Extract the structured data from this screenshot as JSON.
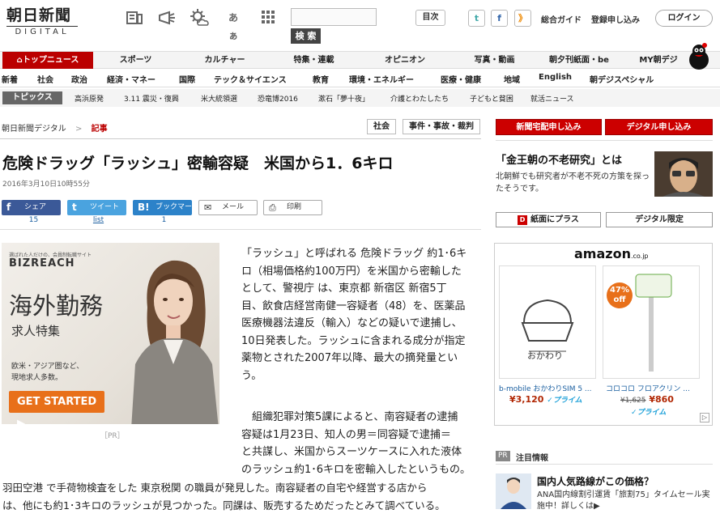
{
  "header": {
    "logo_top": "朝日新聞",
    "logo_bottom": "DIGITAL",
    "search_button": "検 索",
    "index_button": "目次",
    "twitter": "t",
    "facebook": "f",
    "rss": "》",
    "guide": "総合ガイド",
    "signup": "登録申し込み",
    "login": "ログイン",
    "lang_icon": "あぁ"
  },
  "nav_main": [
    "トップニュース",
    "スポーツ",
    "カルチャー",
    "特集・連載",
    "オピニオン",
    "写真・動画",
    "朝夕刊紙面・be",
    "MY朝デジ"
  ],
  "nav_sub": [
    "新着",
    "社会",
    "政治",
    "経済・マネー",
    "国際",
    "テック＆サイエンス",
    "教育",
    "環境・エネルギー",
    "医療・健康",
    "地域",
    "English",
    "朝デジスペシャル"
  ],
  "topics": {
    "label": "トピックス",
    "items": [
      "高浜原発",
      "3.11 震災・復興",
      "米大統領選",
      "恐竜博2016",
      "漱石「夢十夜」",
      "介護とわたしたち",
      "子どもと貧困",
      "就活ニュース"
    ]
  },
  "breadcrumb": {
    "home": "朝日新聞デジタル",
    "sep": ">",
    "current": "記事"
  },
  "tags": [
    "社会",
    "事件・事故・裁判"
  ],
  "article": {
    "title": "危険ドラッグ「ラッシュ」密輸容疑　米国から1．6キロ",
    "date": "2016年3月10日10時55分",
    "p1": [
      "「ラッシュ」と呼ばれる 危険ドラッグ 約1･6キ",
      "ロ（相場価格約100万円）を米国から密輸した",
      "として、警視庁 は、東京都 新宿区 新宿5丁",
      "目、飲食店経営南健一容疑者（48）を、医薬品",
      "医療機器法違反（輸入）などの疑いで逮捕し、",
      "10日発表した。ラッシュに含まれる成分が指定",
      "薬物とされた2007年以降、最大の摘発量とい",
      "う。"
    ],
    "p2": [
      "　組織犯罪対策5課によると、南容疑者の逮捕",
      "容疑は1月23日、知人の男＝同容疑で逮捕＝",
      "と共謀し、米国からスーツケースに入れた液体",
      "のラッシュ約1･6キロを密輸入したというもの。"
    ],
    "p2_full": [
      "羽田空港 で手荷物検査をした 東京税関 の職員が発見した。南容疑者の自宅や経営する店から",
      "は、他にも約1･3キロのラッシュが見つかった。同課は、販売するためだったとみて調べている。"
    ]
  },
  "share": {
    "facebook": {
      "icon": "f",
      "label": "シェア",
      "count": "15"
    },
    "twitter": {
      "icon": "t",
      "label": "ツイート",
      "count": "list"
    },
    "hatena": {
      "icon": "B!",
      "label": "ブックマーク",
      "count": "1"
    },
    "mail": {
      "icon": "✉",
      "label": "メール"
    },
    "print": {
      "icon": "⎙",
      "label": "印刷"
    }
  },
  "ad": {
    "tagline": "選ばれた人だけの、会員制転職サイト",
    "brand": "BIZREACH",
    "headline": "海外勤務",
    "subheadline": "求人特集",
    "body": [
      "欧米・アジア圏など、",
      "現地求人多数。"
    ],
    "cta": "GET STARTED",
    "pr": "［PR］"
  },
  "sidebar": {
    "btn_subscribe": "新聞宅配申し込み",
    "btn_digital": "デジタル申し込み",
    "promo_title": "「金王朝の不老研究」とは",
    "promo_text": "北朝鮮でも研究者が不老不死の方策を探ったそうです。",
    "btn_paper": "紙面にプラス",
    "btn_limited": "デジタル限定",
    "amazon_logo": "amazon",
    "amazon_suffix": ".co.jp",
    "products": [
      {
        "name": "b-mobile おかわりSIM 5 ...",
        "price": "¥3,120",
        "prime": "✓プライム",
        "label": "おかわり"
      },
      {
        "name": "コロコロ フロアクリン ...",
        "old_price": "¥1,625",
        "price": "¥860",
        "prime": "✓プライム",
        "badge": "47%",
        "badge_sub": "off"
      }
    ],
    "pr_label": "PR",
    "pr_title": "注目情報",
    "ana_title": "国内人気路線がこの価格？",
    "ana_text": "ANA国内線割引運賃「旅割75」タイムセール実施中！詳しくは▶"
  }
}
